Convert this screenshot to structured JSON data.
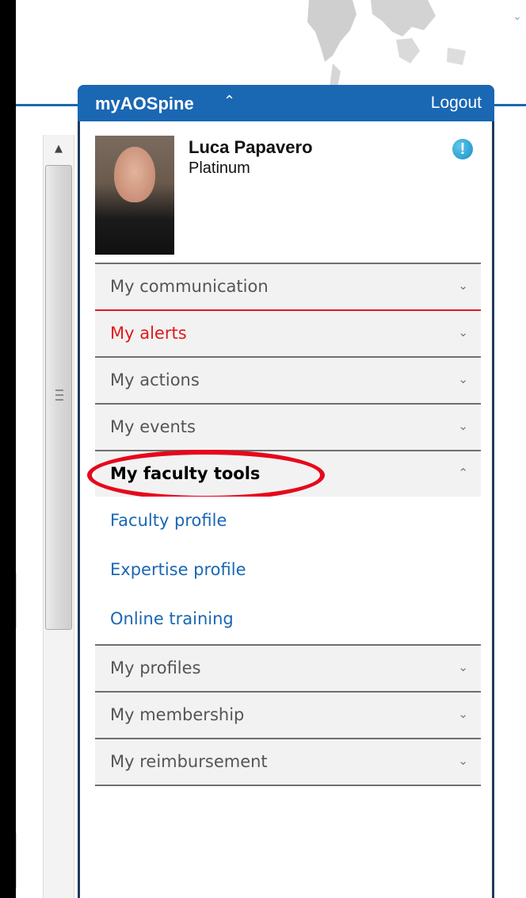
{
  "panel": {
    "brand": "myAOSpine",
    "logout": "Logout"
  },
  "user": {
    "name": "Luca Papavero",
    "level": "Platinum",
    "alert_glyph": "!"
  },
  "menu": {
    "communication": "My communication",
    "alerts": "My alerts",
    "actions": "My actions",
    "events": "My events",
    "faculty_tools": "My faculty tools",
    "faculty_profile": "Faculty profile",
    "expertise_profile": "Expertise profile",
    "online_training": "Online training",
    "profiles": "My profiles",
    "membership": "My membership",
    "reimbursement": "My reimbursement"
  },
  "colors": {
    "header_blue": "#1a67b3",
    "alert_red": "#e0191b",
    "highlight_red": "#e6081c",
    "link_blue": "#1a67b3"
  },
  "icons": {
    "collapsed": "chevron-down-icon",
    "expanded": "chevron-up-icon",
    "notice": "info-alert-icon"
  }
}
